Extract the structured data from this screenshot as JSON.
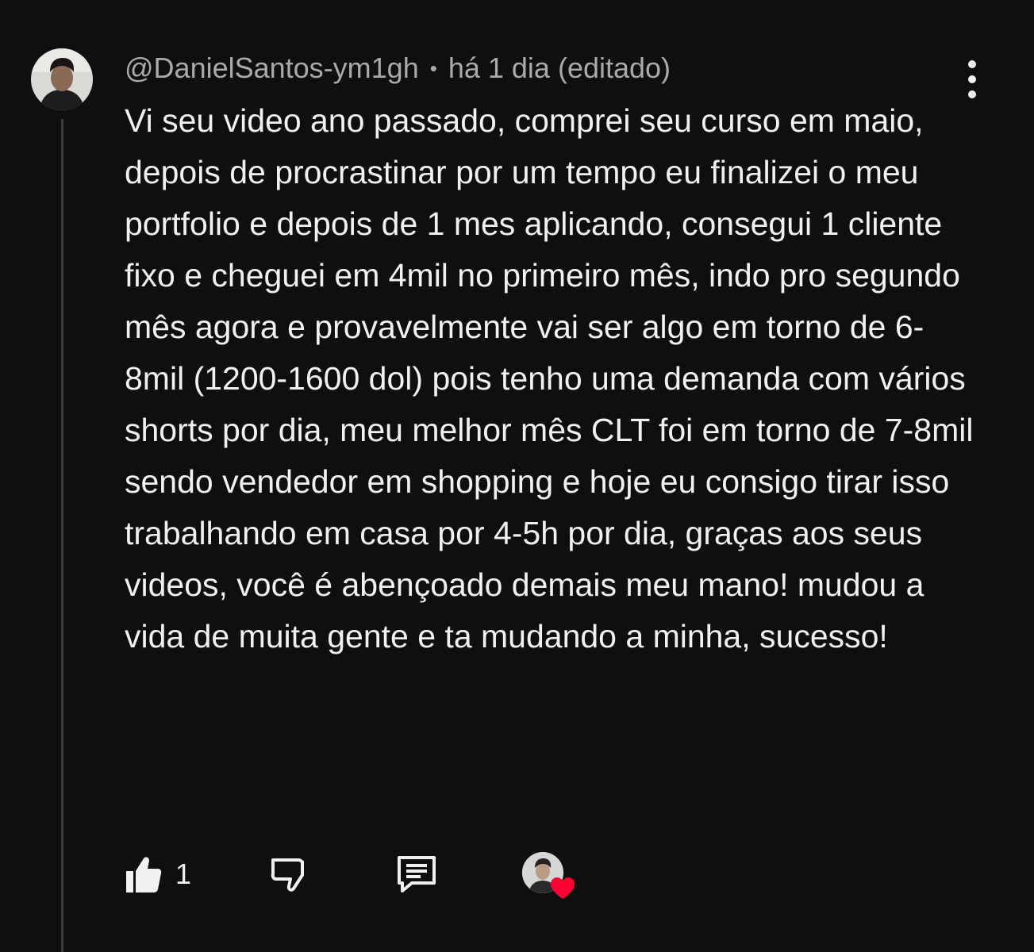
{
  "comment": {
    "author": "@DanielSantos-ym1gh",
    "separator": "•",
    "time": "há 1 dia (editado)",
    "text": "Vi seu video ano passado, comprei seu curso em maio, depois de procrastinar por um tempo eu finalizei o meu portfolio e depois de 1 mes aplicando, consegui 1 cliente fixo e cheguei em 4mil no primeiro mês, indo pro segundo mês agora e provavelmente vai ser algo em torno de 6-8mil (1200-1600 dol) pois tenho uma demanda com vários shorts por dia, meu melhor mês CLT foi em torno de 7-8mil sendo vendedor em shopping e hoje eu consigo tirar isso trabalhando em casa por 4-5h por dia, graças aos seus videos, você é abençoado demais meu mano! mudou a vida de muita gente e ta mudando a minha, sucesso!",
    "like_count": "1"
  },
  "icons": {
    "more": "more-vertical-icon",
    "like": "thumbs-up-icon",
    "dislike": "thumbs-down-icon",
    "reply": "reply-comment-icon",
    "heart": "creator-heart-icon"
  },
  "colors": {
    "background": "#0f0f0f",
    "text": "#f1f1f1",
    "meta": "#aaaaaa",
    "heart": "#ff0033"
  }
}
